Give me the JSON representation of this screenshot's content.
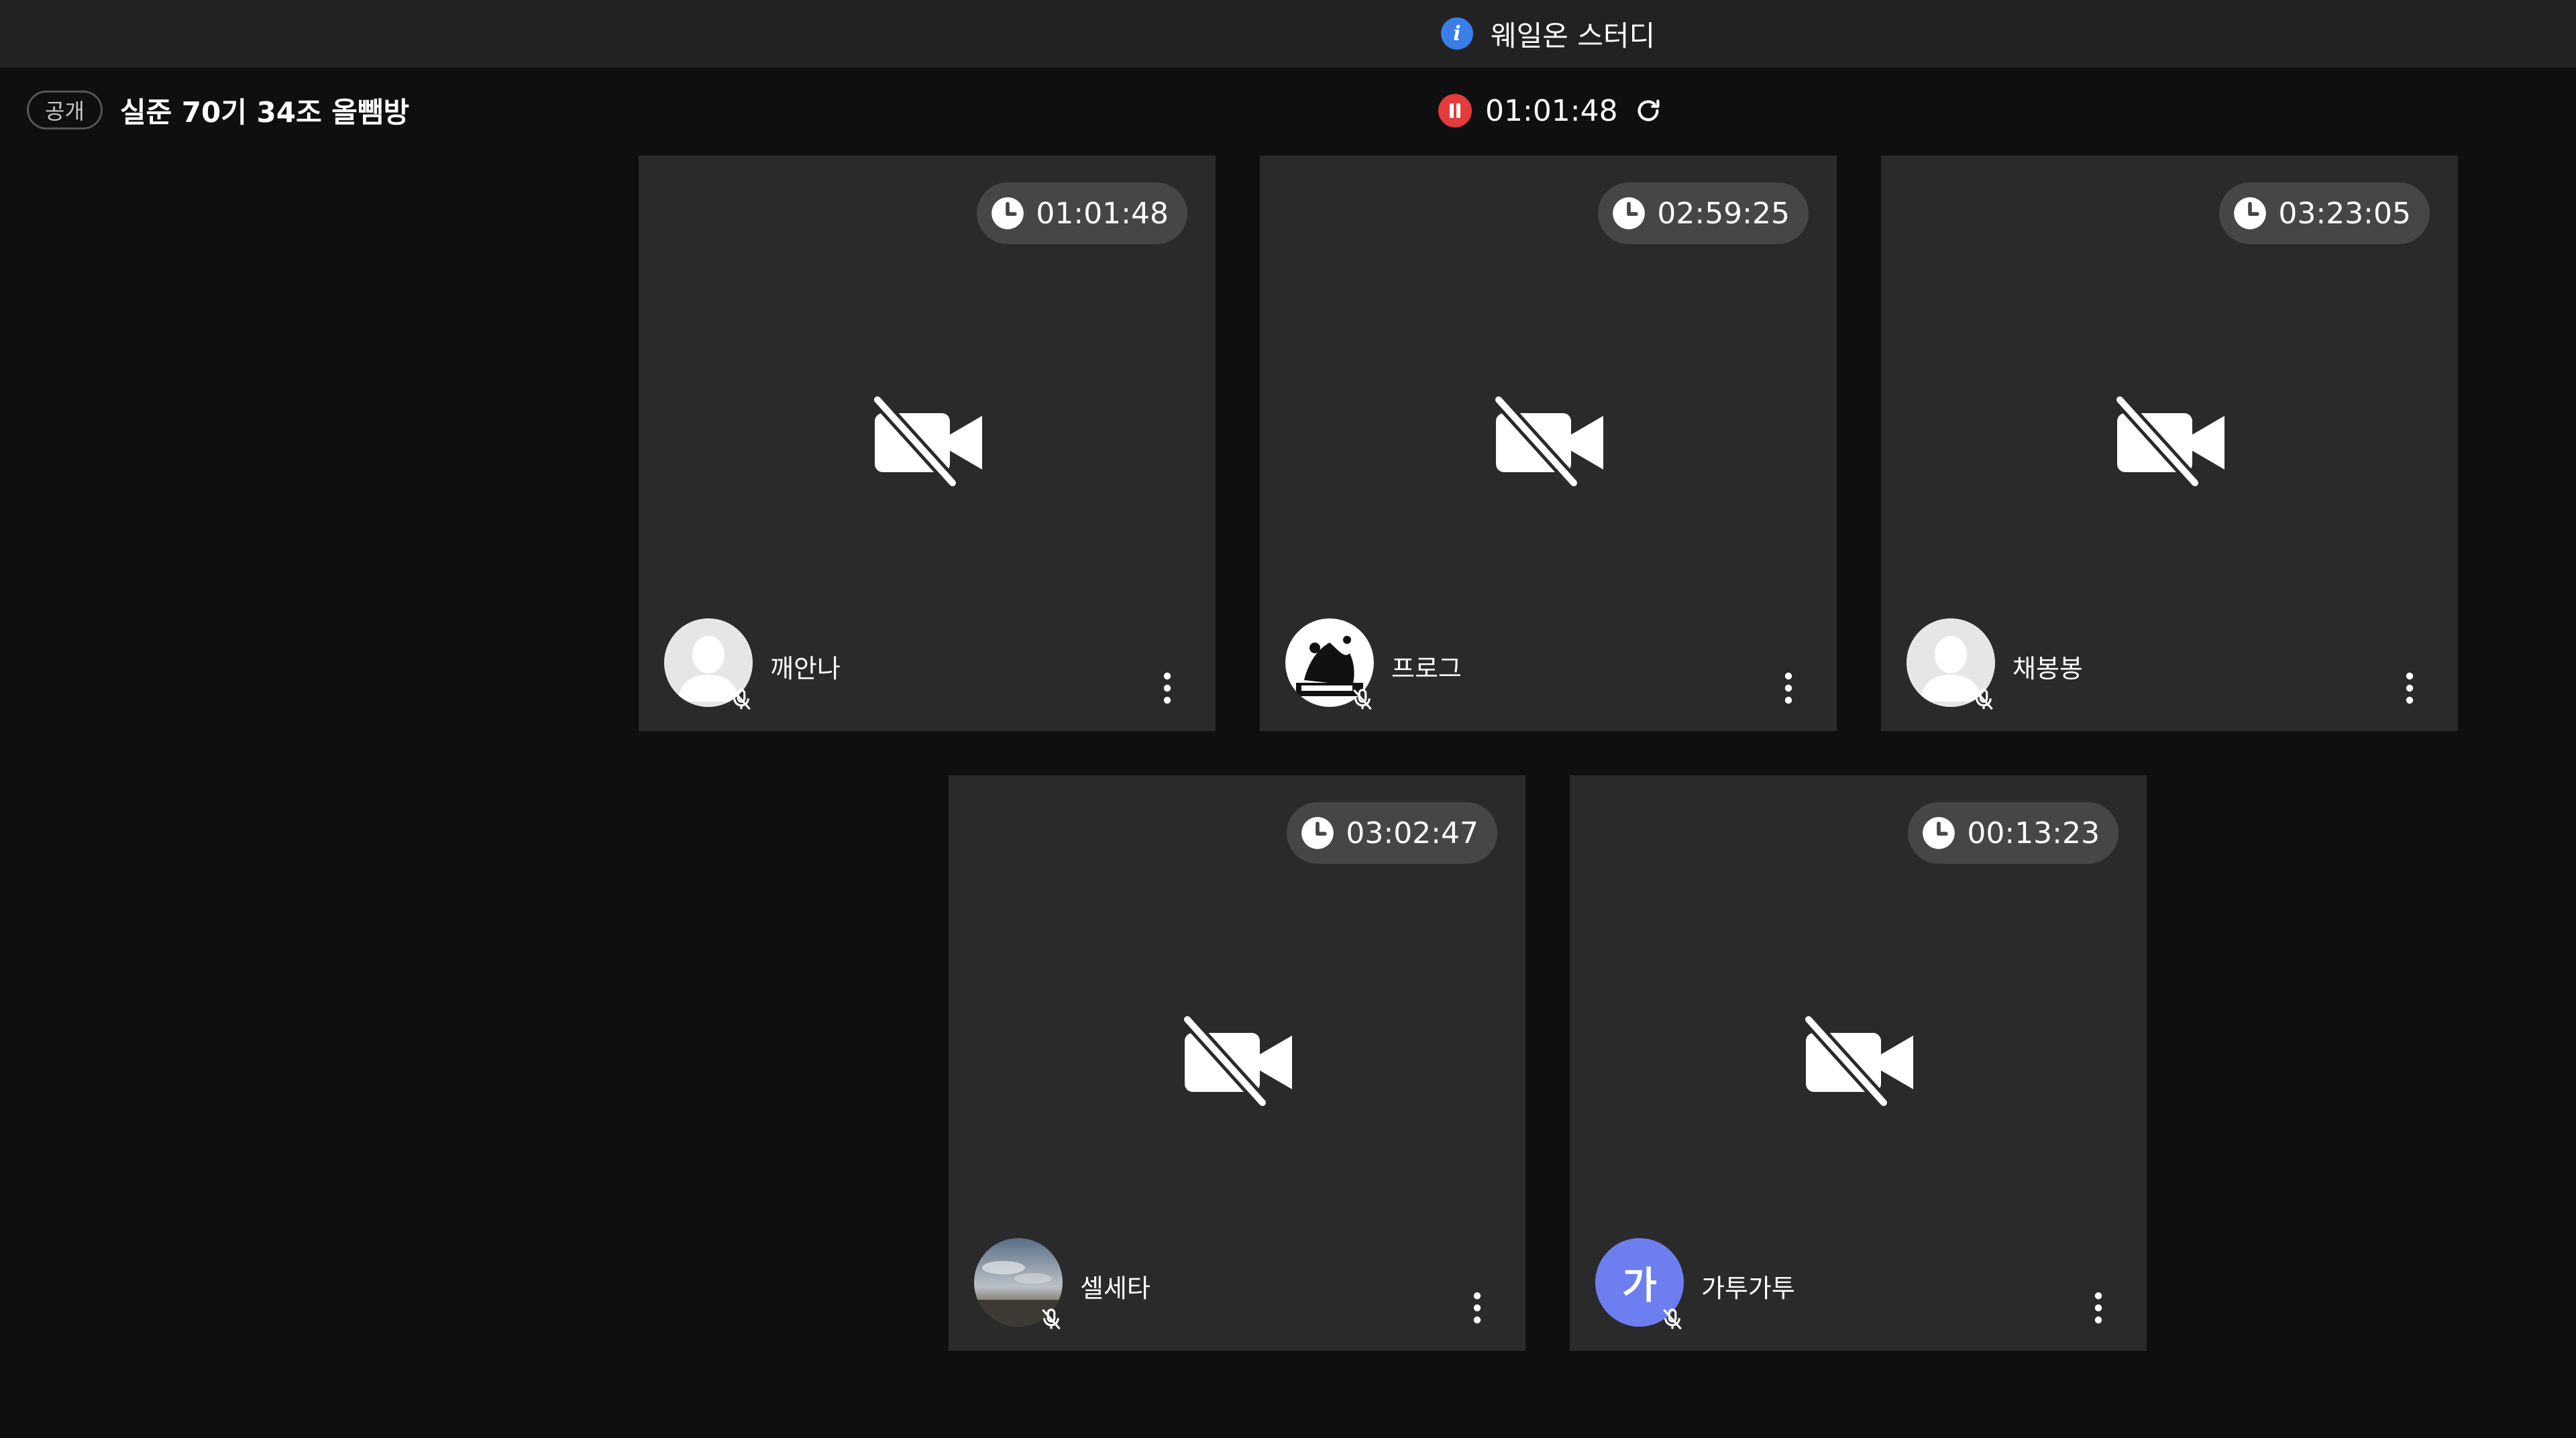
{
  "window": {
    "title": "웨일온 스터디",
    "info_icon": "info-icon",
    "accent": "#3a7ee8"
  },
  "room": {
    "badge": "공개",
    "name": "실준 70기 34조 올뺌방"
  },
  "session_timer": {
    "time": "01:01:48",
    "pause_icon": "pause-icon",
    "refresh_icon": "refresh-icon",
    "pause_color": "#e43b3b"
  },
  "participants": [
    {
      "name": "깨안나",
      "duration": "01:01:48",
      "avatar": "default-avatar",
      "camera": "camera-off",
      "mic": "muted"
    },
    {
      "name": "프로그",
      "duration": "02:59:25",
      "avatar": "image-avatar",
      "camera": "camera-off",
      "mic": "muted"
    },
    {
      "name": "채봉봉",
      "duration": "03:23:05",
      "avatar": "default-avatar",
      "camera": "camera-off",
      "mic": "muted"
    },
    {
      "name": "셀세타",
      "duration": "03:02:47",
      "avatar": "image-avatar",
      "camera": "camera-off",
      "mic": "muted"
    },
    {
      "name": "가투가투",
      "duration": "00:13:23",
      "avatar": "letter-avatar",
      "avatar_letter": "가",
      "avatar_color": "#6d7ff0",
      "camera": "camera-off",
      "mic": "muted"
    }
  ]
}
